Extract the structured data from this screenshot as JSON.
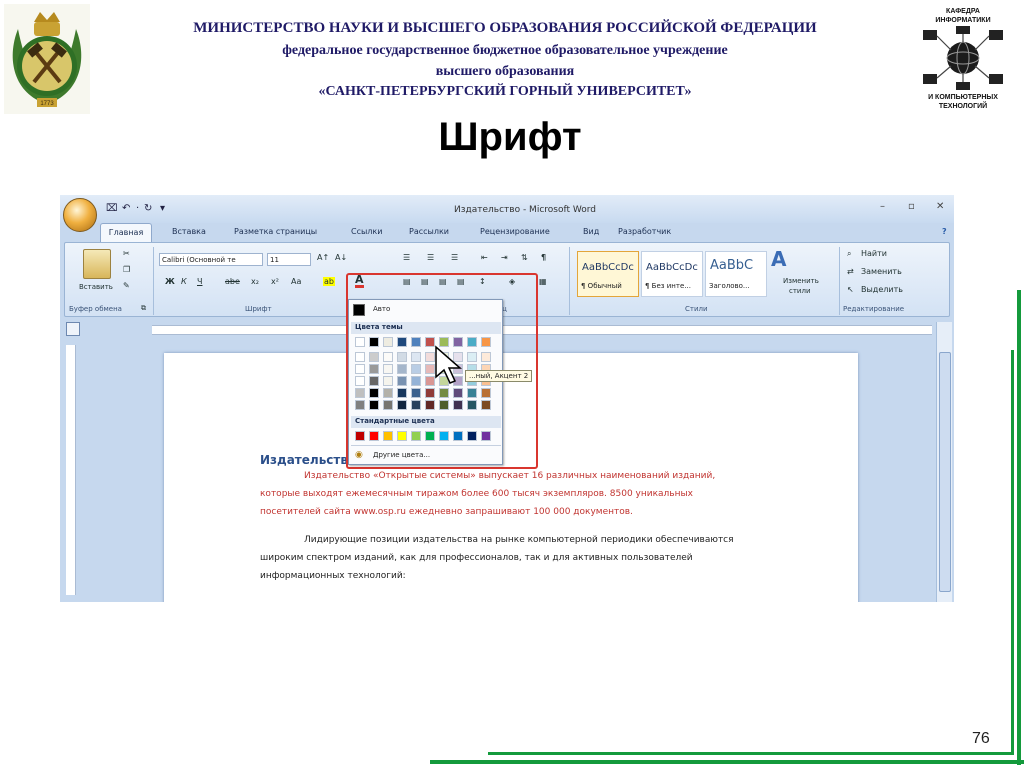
{
  "header": {
    "ministry": "МИНИСТЕРСТВО НАУКИ И ВЫСШЕГО ОБРАЗОВАНИЯ РОССИЙСКОЙ ФЕДЕРАЦИИ",
    "institution_type": "федеральное государственное бюджетное образовательное учреждение",
    "higher_education": "высшего образования",
    "university": "«САНКТ-ПЕТЕРБУРГСКИЙ ГОРНЫЙ УНИВЕРСИТЕТ»",
    "department_top": [
      "КАФЕДРА",
      "ИНФОРМАТИКИ"
    ],
    "department_bottom": [
      "И КОМПЬЮТЕРНЫХ",
      "ТЕХНОЛОГИЙ"
    ],
    "emblem_year": "1773"
  },
  "slide": {
    "title": "Шрифт",
    "page_number": "76"
  },
  "colors": {
    "green_frame": "#149a3c",
    "header_text": "#1f1a66",
    "red_highlight": "#d9362f"
  },
  "word": {
    "window_title": "Издательство - Microsoft Word",
    "quick_access": [
      "⌧",
      "↶",
      "·",
      "↻",
      "▾"
    ],
    "window_controls": [
      "–",
      "▫",
      "✕"
    ],
    "help_icon": "?",
    "tabs": [
      "Главная",
      "Вставка",
      "Разметка страницы",
      "Ссылки",
      "Рассылки",
      "Рецензирование",
      "Вид",
      "Разработчик"
    ],
    "clipboard": {
      "paste_label": "Вставить",
      "group_label": "Буфер обмена"
    },
    "font_group": {
      "font_name": "Calibri (Основной те",
      "font_size": "11",
      "group_label": "Шрифт",
      "grow": "A↑",
      "shrink": "A↓",
      "buttons": [
        "Ж",
        "К",
        "Ч",
        "abe",
        "x₂",
        "x²",
        "Aa"
      ],
      "highlight": "ab",
      "font_color": "A"
    },
    "paragraph_group": {
      "group_label": "Абзац",
      "pilcrow": "¶"
    },
    "styles_group": {
      "cards": [
        {
          "sample": "AaBbCcDc",
          "name": "¶ Обычный"
        },
        {
          "sample": "AaBbCcDc",
          "name": "¶ Без инте..."
        },
        {
          "sample": "AaBbC",
          "name": "Заголово..."
        }
      ],
      "change_styles": [
        "Изменить",
        "стили"
      ],
      "group_label": "Стили"
    },
    "editing_group": {
      "find": "Найти",
      "replace": "Заменить",
      "select": "Выделить",
      "group_label": "Редактирование"
    },
    "color_menu": {
      "auto": "Авто",
      "theme_header": "Цвета темы",
      "standard_header": "Стандартные цвета",
      "more_colors": "Другие цвета...",
      "tooltip": "...ный, Акцент 2",
      "theme_colors": [
        "#ffffff",
        "#000000",
        "#eeece1",
        "#1f497d",
        "#4f81bd",
        "#c0504d",
        "#9bbb59",
        "#8064a2",
        "#4bacc6",
        "#f79646"
      ],
      "standard_colors": [
        "#c00000",
        "#ff0000",
        "#ffc000",
        "#ffff00",
        "#92d050",
        "#00b050",
        "#00b0f0",
        "#0070c0",
        "#002060",
        "#7030a0"
      ]
    },
    "document": {
      "heading": "Издательств... ...темы»",
      "red_lines": [
        "Издательство «Открытые системы» выпускает 16 различных наименований изданий,",
        "которые выходят ежемесячным тиражом более 600 тысяч экземпляров. 8500 уникальных",
        "посетителей сайта www.osp.ru ежедневно запрашивают 100 000 документов."
      ],
      "black_lines": [
        "Лидирующие позиции издательства на рынке компьютерной периодики обеспечиваются",
        "широким спектром изданий, как для профессионалов, так и для активных пользователей",
        "информационных технологий:"
      ]
    }
  }
}
